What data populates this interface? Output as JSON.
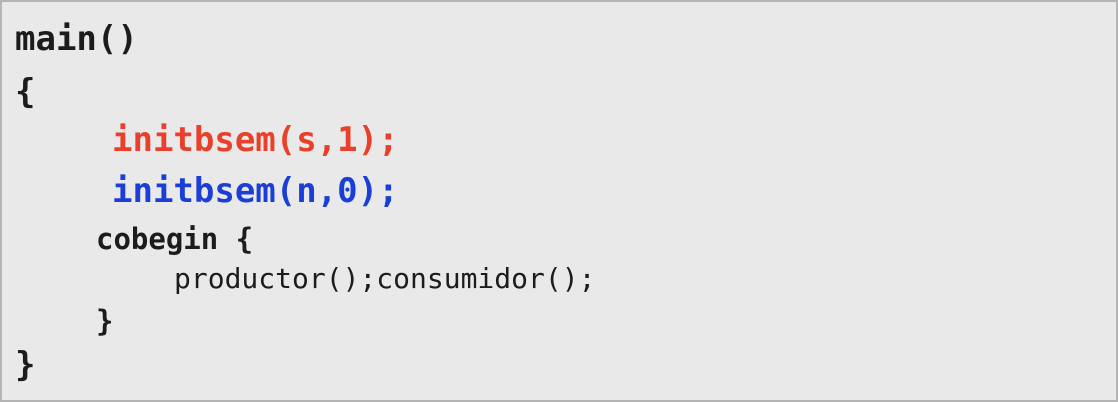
{
  "code": {
    "lines": [
      {
        "text": "main()"
      },
      {
        "text": "{"
      },
      {
        "text": "initbsem(s,1);",
        "color": "#e8402a"
      },
      {
        "text": "initbsem(n,0);",
        "color": "#1b3fd6"
      },
      {
        "text": "cobegin {"
      },
      {
        "text": "productor();consumidor();"
      },
      {
        "text": "}"
      },
      {
        "text": "}"
      }
    ]
  }
}
